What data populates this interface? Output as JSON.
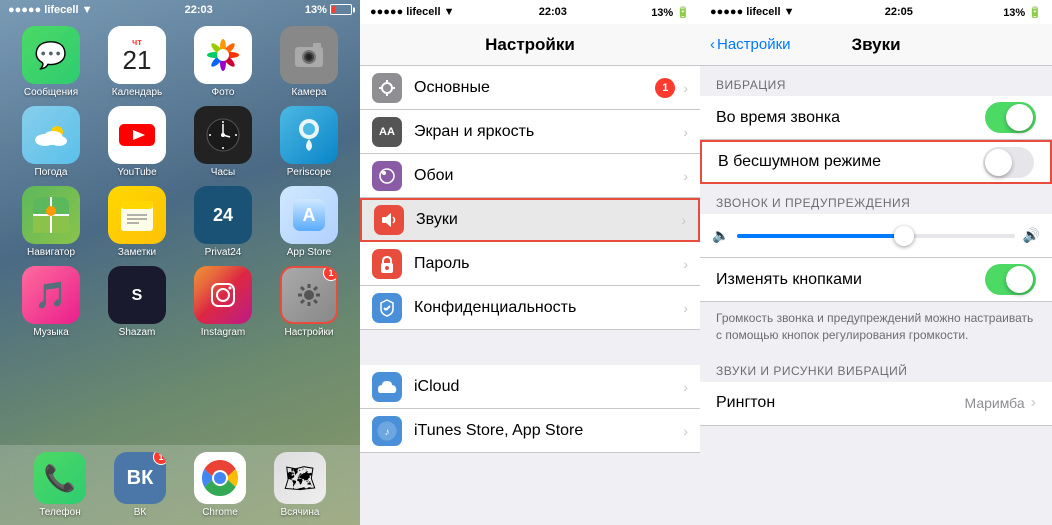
{
  "phone1": {
    "carrier": "lifecell",
    "time": "22:03",
    "battery": "13%",
    "apps_row1": [
      {
        "label": "Сообщения",
        "icon_class": "icon-messages",
        "emoji": "💬"
      },
      {
        "label": "Календарь",
        "icon_class": "icon-calendar",
        "special": "calendar",
        "day": "чт",
        "date": "21"
      },
      {
        "label": "Фото",
        "icon_class": "icon-photos",
        "special": "photos"
      },
      {
        "label": "Камера",
        "icon_class": "icon-camera",
        "emoji": "📷"
      }
    ],
    "apps_row2": [
      {
        "label": "Погода",
        "icon_class": "icon-weather",
        "emoji": "🌤"
      },
      {
        "label": "YouTube",
        "icon_class": "icon-youtube",
        "special": "youtube"
      },
      {
        "label": "Часы",
        "icon_class": "icon-clock",
        "special": "clock"
      },
      {
        "label": "Periscope",
        "icon_class": "icon-periscope",
        "emoji": "📡"
      }
    ],
    "apps_row3": [
      {
        "label": "Навигатор",
        "icon_class": "icon-maps",
        "emoji": "🗺"
      },
      {
        "label": "Заметки",
        "icon_class": "icon-notes",
        "emoji": "📝"
      },
      {
        "label": "Privat24",
        "icon_class": "icon-privat",
        "text": "24"
      },
      {
        "label": "App Store",
        "icon_class": "icon-appstore",
        "special": "appstore"
      }
    ],
    "apps_row4": [
      {
        "label": "Музыка",
        "icon_class": "icon-music",
        "emoji": "🎵"
      },
      {
        "label": "Shazam",
        "icon_class": "icon-shazam",
        "emoji": "🎵"
      },
      {
        "label": "Instagram",
        "icon_class": "icon-instagram",
        "special": "instagram"
      },
      {
        "label": "Настройки",
        "icon_class": "icon-settings-red",
        "special": "settings",
        "badge": "1"
      }
    ],
    "dock": [
      {
        "label": "Телефон",
        "icon_class": "icon-phone",
        "emoji": "📞"
      },
      {
        "label": "ВК",
        "icon_class": "icon-vk",
        "text": "ВК",
        "badge": "1"
      },
      {
        "label": "Chrome",
        "icon_class": "icon-chrome",
        "special": "chrome"
      },
      {
        "label": "Всячина",
        "icon_class": "icon-maps2",
        "emoji": "🗺"
      }
    ]
  },
  "phone2": {
    "carrier": "lifecell",
    "time": "22:03",
    "battery": "13%",
    "title": "Настройки",
    "rows": [
      {
        "icon_class": "si-general",
        "icon_bg": "#8e8e93",
        "label": "Основные",
        "badge": "1",
        "chevron": true
      },
      {
        "icon_class": "si-display",
        "icon_bg": "#555",
        "label": "Экран и яркость",
        "badge": "",
        "chevron": true
      },
      {
        "icon_class": "si-wallpaper",
        "icon_bg": "#8a5ca6",
        "label": "Обои",
        "badge": "",
        "chevron": true
      },
      {
        "icon_class": "si-sounds",
        "icon_bg": "#e74c3c",
        "label": "Звуки",
        "badge": "",
        "chevron": true,
        "highlighted": true
      },
      {
        "icon_class": "si-password",
        "icon_bg": "#e74c3c",
        "label": "Пароль",
        "badge": "",
        "chevron": true
      },
      {
        "icon_class": "si-privacy",
        "icon_bg": "#4a90d9",
        "label": "Конфиденциальность",
        "badge": "",
        "chevron": true
      }
    ],
    "rows2": [
      {
        "icon_class": "si-icloud",
        "icon_bg": "#4a90d9",
        "label": "iCloud",
        "badge": "",
        "chevron": true
      },
      {
        "icon_class": "si-itunes",
        "icon_bg": "#4a90d9",
        "label": "iTunes Store, App Store",
        "badge": "",
        "chevron": true
      }
    ]
  },
  "phone3": {
    "carrier": "lifecell",
    "time": "22:05",
    "battery": "13%",
    "back_label": "Настройки",
    "title": "Звуки",
    "vibration_section": "ВИБРАЦИЯ",
    "during_call_label": "Во время звонка",
    "silent_mode_label": "В бесшумном режиме",
    "ringtone_section": "ЗВОНОК И ПРЕДУПРЕЖДЕНИЯ",
    "change_with_buttons_label": "Изменять кнопками",
    "volume_info": "Громкость звонка и предупреждений можно настраивать с помощью кнопок регулирования громкости.",
    "sounds_section": "ЗВУКИ И РИСУНКИ ВИБРАЦИЙ",
    "ringtone_row": "Рингтон",
    "ringtone_value": "Маримба",
    "during_call_toggle": true,
    "silent_mode_toggle": false,
    "change_buttons_toggle": true
  }
}
